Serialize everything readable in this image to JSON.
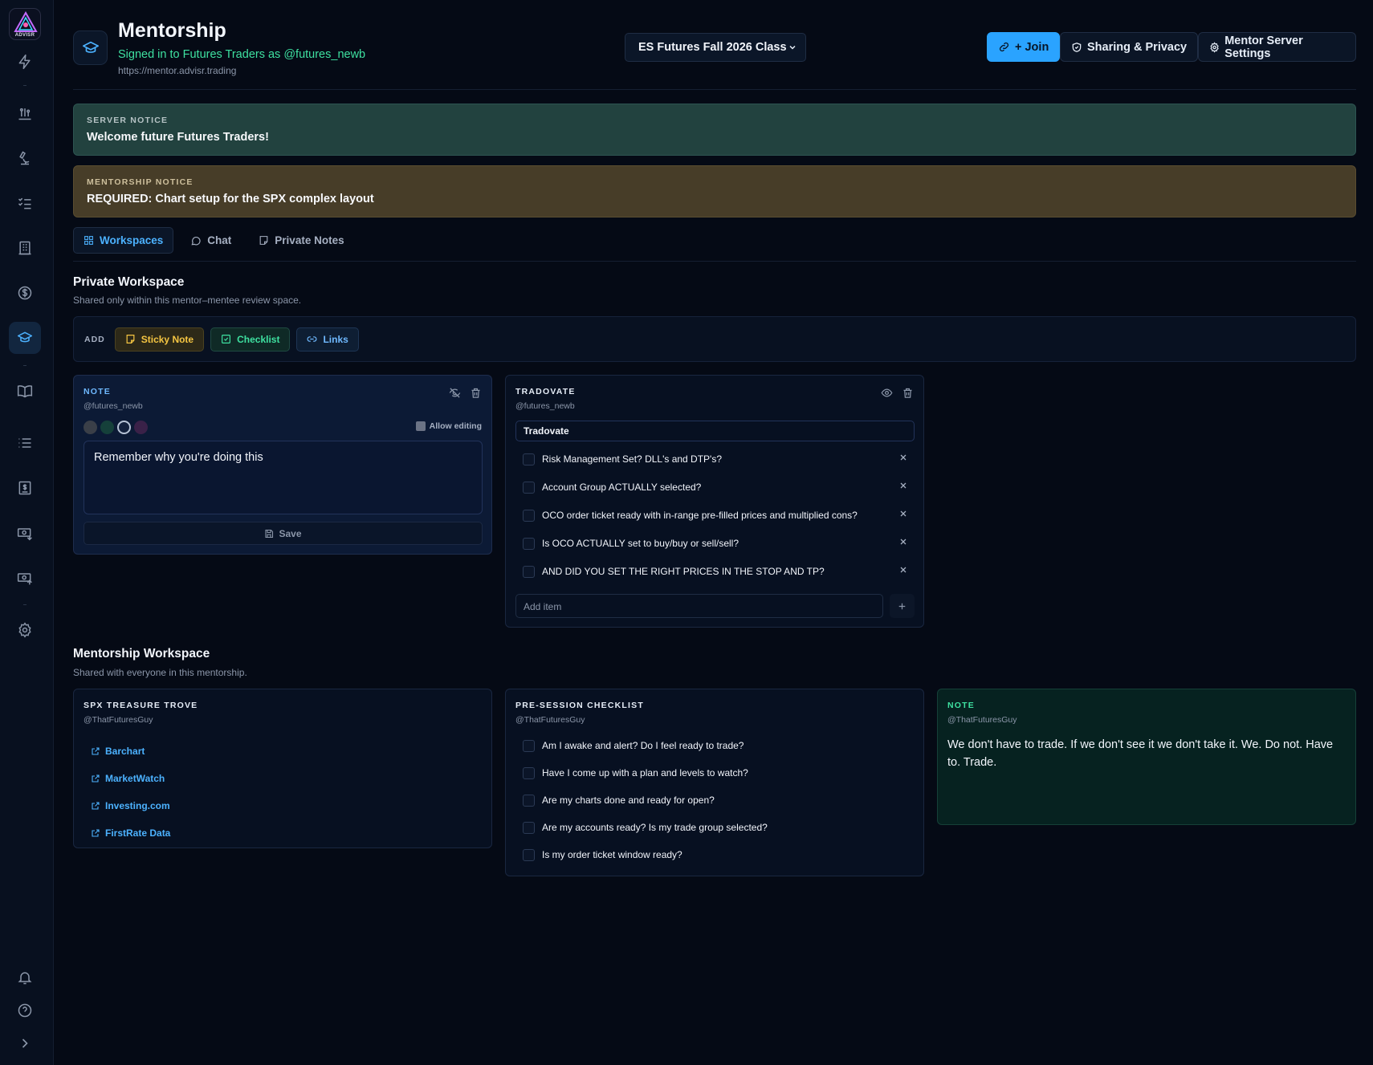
{
  "app": {
    "logo_text": "ADVISR"
  },
  "header": {
    "title": "Mentorship",
    "signed_in": "Signed in to Futures Traders as @futures_newb",
    "server_url": "https://mentor.advisr.trading",
    "class_select": "ES Futures Fall 2026 Class",
    "join_label": "+ Join",
    "sharing_label": "Sharing & Privacy",
    "settings_label": "Mentor Server Settings"
  },
  "notices": {
    "server": {
      "kicker": "SERVER NOTICE",
      "text": "Welcome future Futures Traders!"
    },
    "mentorship": {
      "kicker": "MENTORSHIP NOTICE",
      "text": "REQUIRED: Chart setup for the SPX complex layout"
    }
  },
  "tabs": [
    {
      "label": "Workspaces",
      "active": true
    },
    {
      "label": "Chat",
      "active": false
    },
    {
      "label": "Private Notes",
      "active": false
    }
  ],
  "private_workspace": {
    "title": "Private Workspace",
    "subtitle": "Shared only within this mentor–mentee review space.",
    "add_label": "ADD",
    "add_buttons": [
      "Sticky Note",
      "Checklist",
      "Links"
    ],
    "note": {
      "kicker": "NOTE",
      "author": "@futures_newb",
      "allow_editing": "Allow editing",
      "swatch_colors": [
        "#3a3f48",
        "#15403a",
        "#13213d",
        "#3a2148"
      ],
      "text": "Remember why you're doing this",
      "save_label": "Save"
    },
    "tradovate": {
      "kicker": "TRADOVATE",
      "author": "@futures_newb",
      "title_value": "Tradovate",
      "items": [
        "Risk Management Set? DLL's and DTP's?",
        "Account Group ACTUALLY selected?",
        "OCO order ticket ready with in-range pre-filled prices and multiplied cons?",
        "Is OCO ACTUALLY set to buy/buy or sell/sell?",
        "AND DID YOU SET THE RIGHT PRICES IN THE STOP AND TP?"
      ],
      "add_placeholder": "Add item"
    }
  },
  "mentorship_workspace": {
    "title": "Mentorship Workspace",
    "subtitle": "Shared with everyone in this mentorship.",
    "links_card": {
      "kicker": "SPX TREASURE TROVE",
      "author": "@ThatFuturesGuy",
      "links": [
        "Barchart",
        "MarketWatch",
        "Investing.com",
        "FirstRate Data"
      ]
    },
    "pre_session": {
      "kicker": "PRE-SESSION CHECKLIST",
      "author": "@ThatFuturesGuy",
      "items": [
        "Am I awake and alert? Do I feel ready to trade?",
        "Have I come up with a plan and levels to watch?",
        "Are my charts done and ready for open?",
        "Are my accounts ready? Is my trade group selected?",
        "Is my order ticket window ready?"
      ]
    },
    "note": {
      "kicker": "NOTE",
      "author": "@ThatFuturesGuy",
      "text": "We don't have to trade. If we don't see it we don't take it. We. Do not. Have to. Trade."
    }
  }
}
